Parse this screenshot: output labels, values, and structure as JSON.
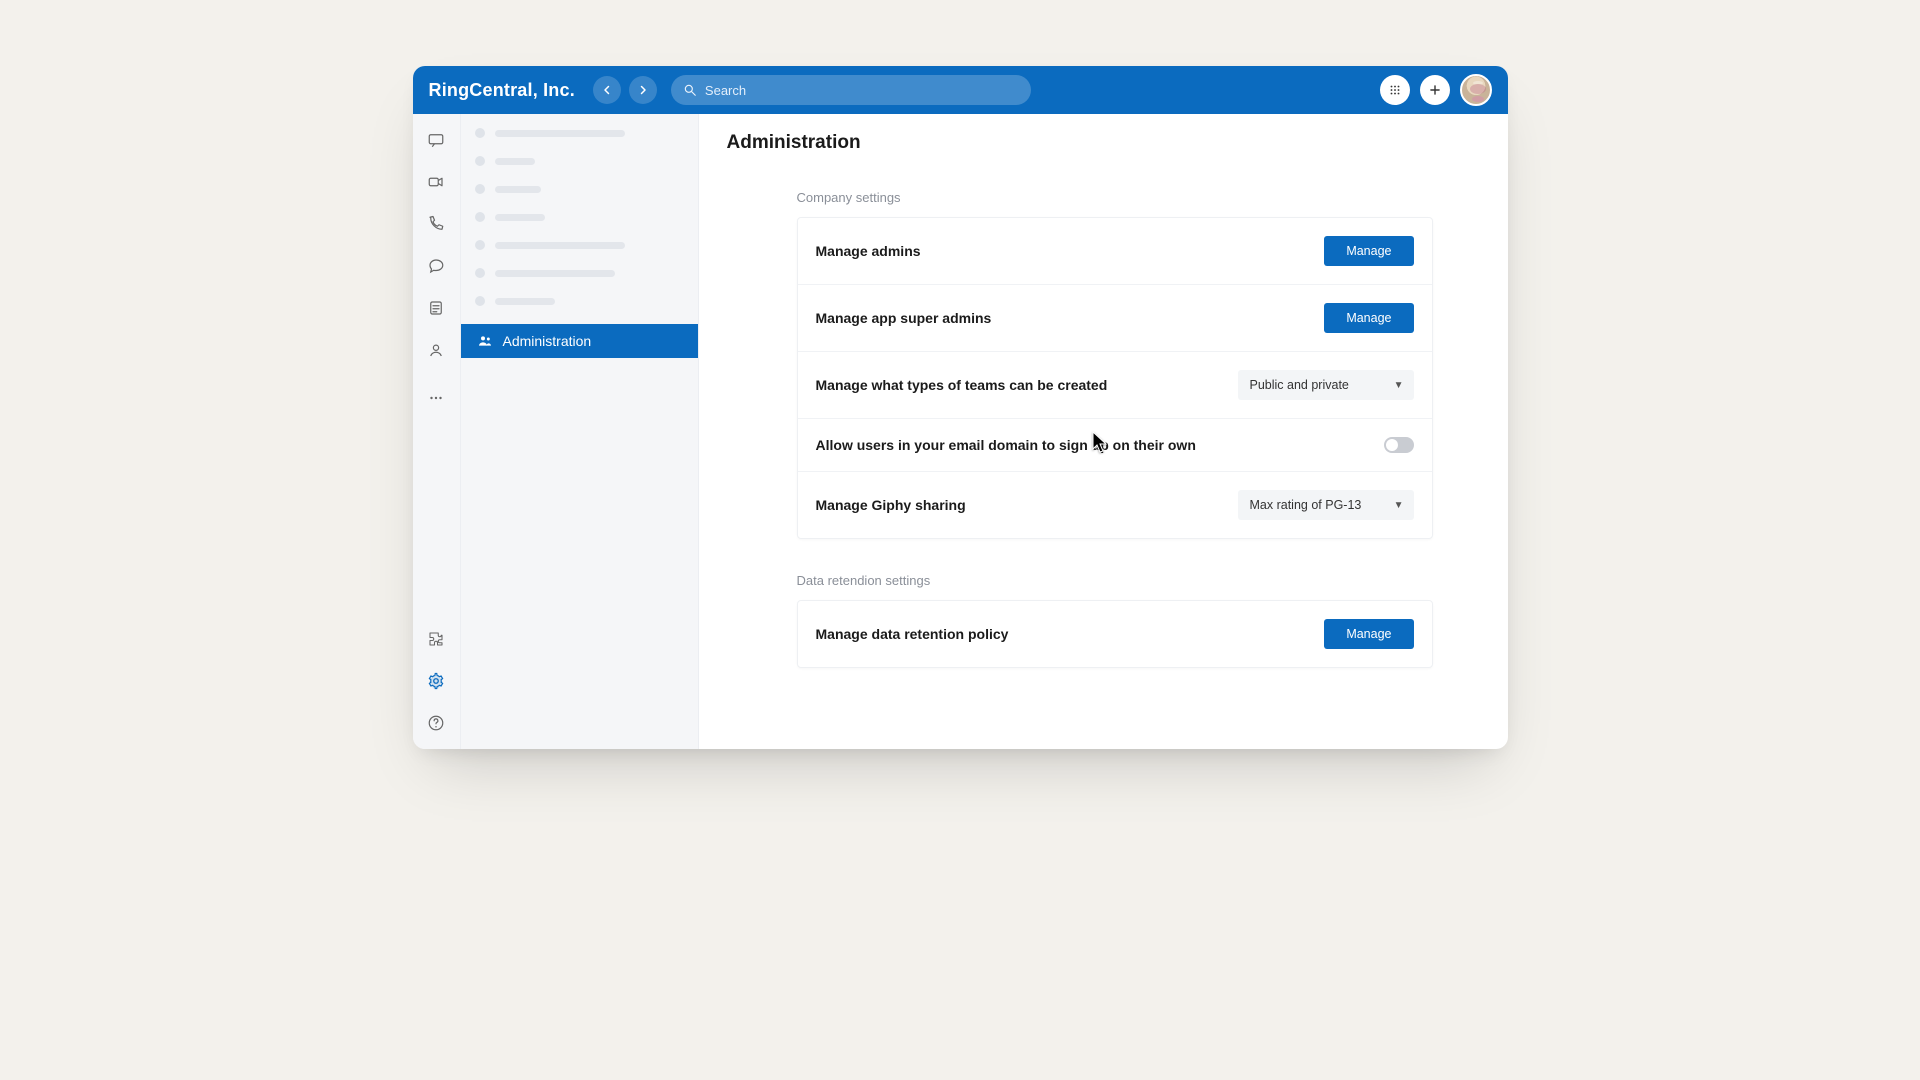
{
  "header": {
    "brand": "RingCentral, Inc.",
    "search_placeholder": "Search"
  },
  "sidebar": {
    "active_item_label": "Administration"
  },
  "page": {
    "title": "Administration",
    "sections": {
      "company": {
        "label": "Company settings",
        "rows": {
          "manage_admins": {
            "label": "Manage admins",
            "button": "Manage"
          },
          "manage_super_admins": {
            "label": "Manage app super admins",
            "button": "Manage"
          },
          "team_types": {
            "label": "Manage what types of teams can be created",
            "value": "Public and private"
          },
          "self_signup": {
            "label": "Allow users in your email domain to sign up on their own",
            "enabled": false
          },
          "giphy": {
            "label": "Manage Giphy sharing",
            "value": "Max rating of PG-13"
          }
        }
      },
      "retention": {
        "label": "Data retendion settings",
        "rows": {
          "policy": {
            "label": "Manage data retention policy",
            "button": "Manage"
          }
        }
      }
    }
  },
  "colors": {
    "brand": "#0b6bbf"
  }
}
